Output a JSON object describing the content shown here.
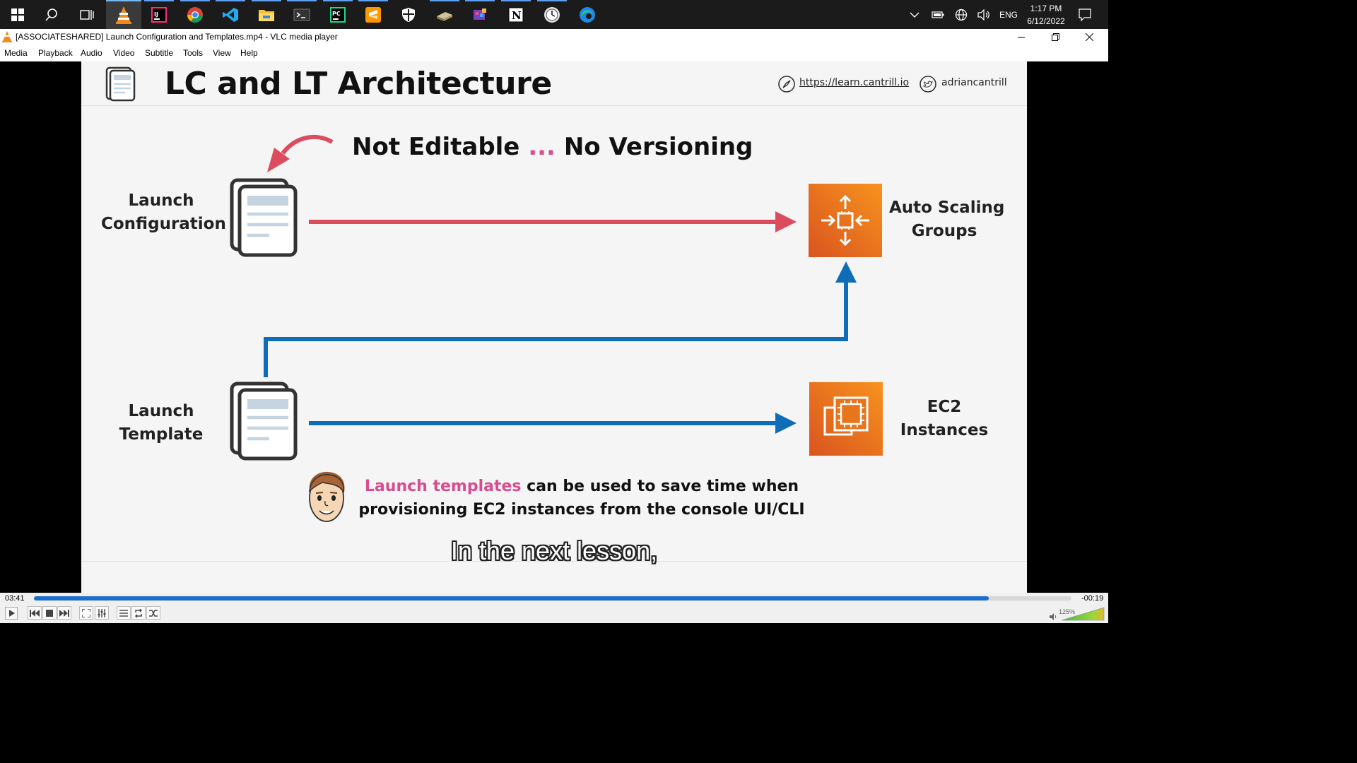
{
  "taskbar": {
    "apps": [
      "start",
      "search",
      "task-view",
      "vlc",
      "intellij",
      "chrome",
      "vscode",
      "file-explorer",
      "terminal",
      "pycharm",
      "sublime-text",
      "windows-security",
      "files-app",
      "photos",
      "notion",
      "clock-app",
      "edge"
    ],
    "language": "ENG",
    "time": "1:17 PM",
    "date": "6/12/2022"
  },
  "window": {
    "title": "[ASSOCIATESHARED] Launch Configuration and Templates.mp4 - VLC media player"
  },
  "menu": {
    "items": [
      "Media",
      "Playback",
      "Audio",
      "Video",
      "Subtitle",
      "Tools",
      "View",
      "Help"
    ]
  },
  "slide": {
    "title": "LC and LT Architecture",
    "link": "https://learn.cantrill.io",
    "twitter": "adriancantrill",
    "note_part1": "Not Editable",
    "note_ellipsis": "...",
    "note_part2": "No Versioning",
    "lc_line1": "Launch",
    "lc_line2": "Configuration",
    "lt_line1": "Launch",
    "lt_line2": "Template",
    "asg_line1": "Auto Scaling",
    "asg_line2": "Groups",
    "ec2_line1": "EC2",
    "ec2_line2": "Instances",
    "bottom_pink": "Launch templates",
    "bottom_rest1": " can be used to save time when",
    "bottom_line2": "provisioning EC2 instances from the console UI/CLI",
    "colors": {
      "red_arrow": "#dc4b5e",
      "blue_arrow": "#0f6cb6",
      "aws_orange": "#e8741b",
      "pink_text": "#d84d8f"
    }
  },
  "subtitle": "In the next lesson,",
  "player": {
    "elapsed": "03:41",
    "remaining": "-00:19",
    "progress": 0.92,
    "volume": "125%"
  }
}
